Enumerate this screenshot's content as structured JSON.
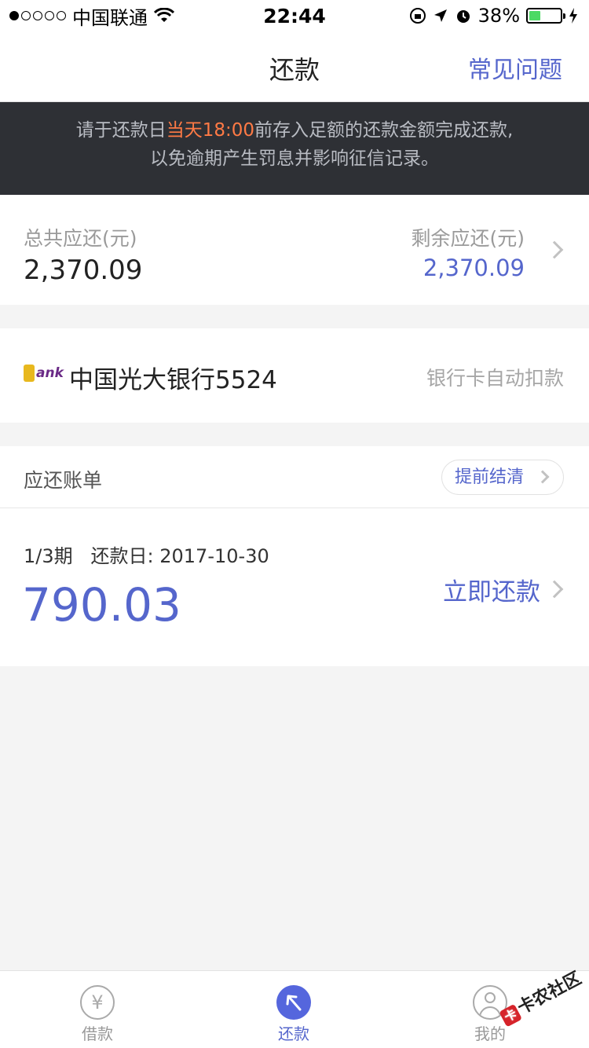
{
  "status_bar": {
    "carrier": "中国联通",
    "time": "22:44",
    "battery": "38%",
    "battery_level": 0.38
  },
  "nav": {
    "title": "还款",
    "faq_label": "常见问题"
  },
  "notice": {
    "prefix": "请于还款日",
    "highlight": "当天18:00",
    "suffix": "前存入足额的还款金额完成还款,",
    "line2": "以免逾期产生罚息并影响征信记录。"
  },
  "summary": {
    "total_label": "总共应还(元)",
    "total_value": "2,370.09",
    "remaining_label": "剩余应还(元)",
    "remaining_value": "2,370.09"
  },
  "bank": {
    "logo_text": "ank",
    "name": "中国光大银行5524",
    "mode": "银行卡自动扣款"
  },
  "bill": {
    "title": "应还账单",
    "settle_label": "提前结清",
    "period": "1/3期",
    "date_label": "还款日:",
    "date": "2017-10-30",
    "amount": "790.03",
    "pay_label": "立即还款"
  },
  "tabs": [
    {
      "label": "借款",
      "icon": "yen-icon"
    },
    {
      "label": "还款",
      "icon": "repay-arrow-icon"
    },
    {
      "label": "我的",
      "icon": "user-icon"
    }
  ],
  "watermark": "卡农社区",
  "colors": {
    "accent": "#5566cc",
    "highlight": "#ff7a45",
    "notice_bg": "#2e3035"
  }
}
